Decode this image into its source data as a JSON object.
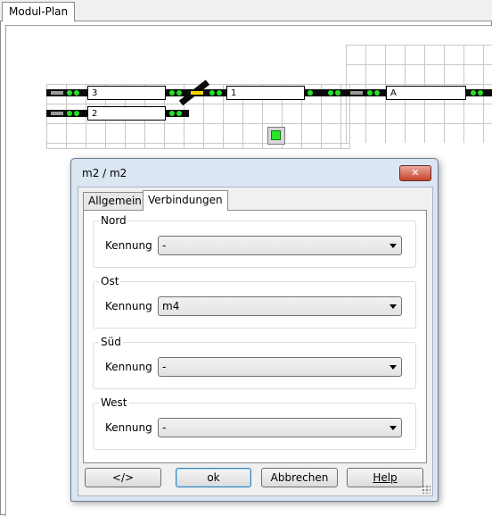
{
  "app": {
    "tab_title": "Modul-Plan"
  },
  "plan": {
    "blocks": [
      {
        "id": "block-3",
        "label": "3"
      },
      {
        "id": "block-2",
        "label": "2"
      },
      {
        "id": "block-1",
        "label": "1"
      },
      {
        "id": "block-a",
        "label": "A"
      }
    ]
  },
  "dialog": {
    "title": "m2 / m2",
    "close_label": "✕",
    "tabs": [
      {
        "label": "Allgemein",
        "active": false
      },
      {
        "label": "Verbindungen",
        "active": true
      }
    ],
    "groups": [
      {
        "title": "Nord",
        "field_label": "Kennung",
        "value": "-"
      },
      {
        "title": "Ost",
        "field_label": "Kennung",
        "value": "m4"
      },
      {
        "title": "Süd",
        "field_label": "Kennung",
        "value": "-"
      },
      {
        "title": "West",
        "field_label": "Kennung",
        "value": "-"
      }
    ],
    "buttons": {
      "code": "</>",
      "ok": "ok",
      "cancel": "Abbrechen",
      "help": "Help"
    }
  },
  "colors": {
    "signal_green": "#27e027",
    "signal_yellow": "#f2d600",
    "close_red": "#c7432d"
  }
}
